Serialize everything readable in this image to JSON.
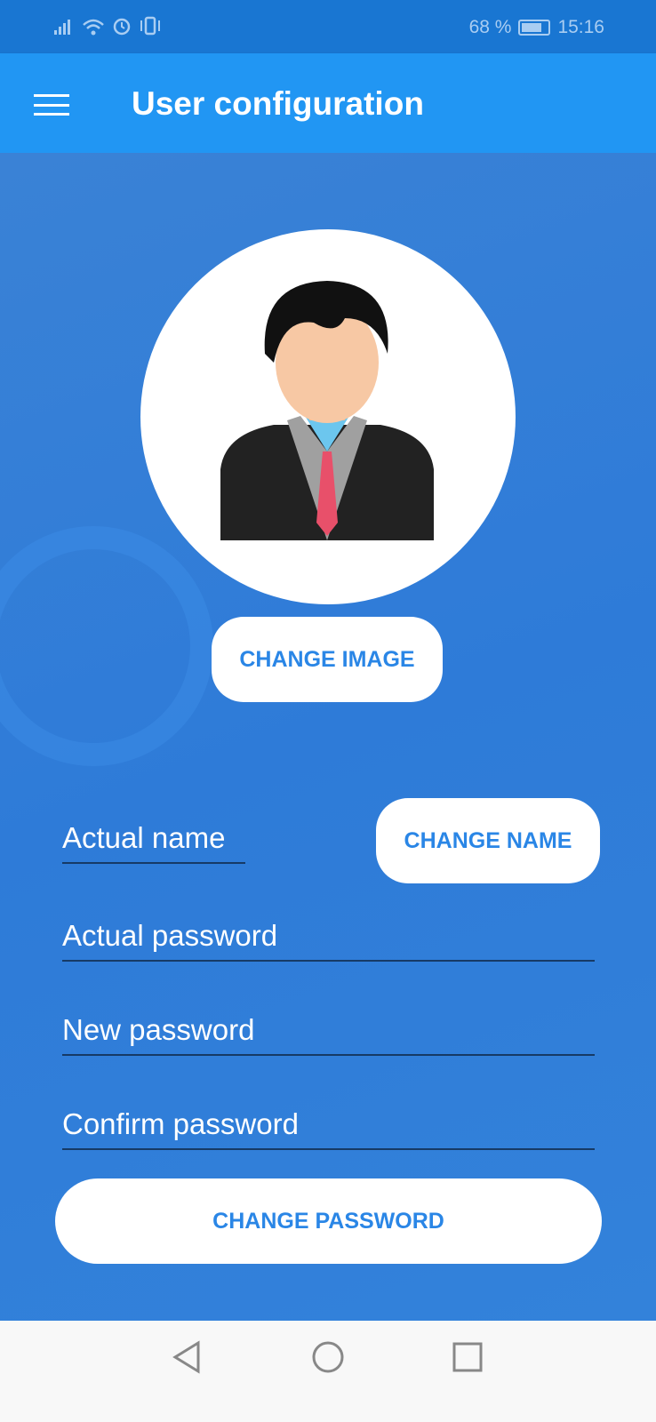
{
  "status_bar": {
    "battery": "68 %",
    "battery_level": 0.68,
    "time": "15:16"
  },
  "app_bar": {
    "title": "User configuration"
  },
  "profile": {
    "change_image_label": "CHANGE IMAGE"
  },
  "form": {
    "name_placeholder": "Actual name",
    "change_name_label": "CHANGE NAME",
    "actual_password_placeholder": "Actual password",
    "new_password_placeholder": "New password",
    "confirm_password_placeholder": "Confirm password",
    "change_password_label": "CHANGE PASSWORD"
  }
}
